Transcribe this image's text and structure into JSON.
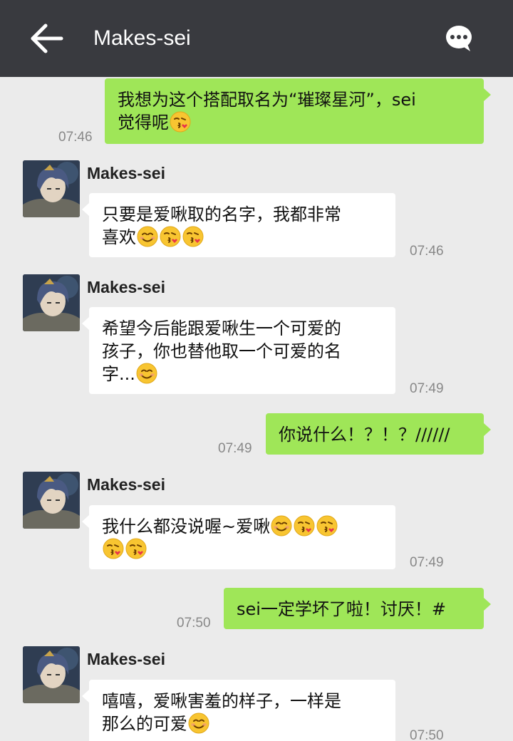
{
  "header": {
    "title": "Makes-sei",
    "back_icon": "arrow-left-icon",
    "menu_icon": "chat-bubble-icon"
  },
  "messages": [
    {
      "dir": "out",
      "time": "07:46",
      "lines": [
        "我想为这个搭配取名为“璀璨星河”，sei",
        "觉得呢"
      ],
      "emoji": [
        "kiss"
      ]
    },
    {
      "dir": "in",
      "sender": "Makes-sei",
      "time": "07:46",
      "lines": [
        "只要是爱啾取的名字，我都非常",
        "喜欢"
      ],
      "emoji": [
        "smile",
        "kiss",
        "kiss"
      ]
    },
    {
      "dir": "in",
      "sender": "Makes-sei",
      "time": "07:49",
      "lines": [
        "希望今后能跟爱啾生一个可爱的",
        "孩子，你也替他取一个可爱的名",
        "字..."
      ],
      "emoji": [
        "smile"
      ]
    },
    {
      "dir": "out",
      "time": "07:49",
      "lines": [
        "你说什么！？！？//////"
      ],
      "emoji": []
    },
    {
      "dir": "in",
      "sender": "Makes-sei",
      "time": "07:49",
      "lines": [
        "我什么都没说喔~爱啾",
        ""
      ],
      "emoji": [
        "smile",
        "kiss",
        "kiss",
        "kiss",
        "kiss"
      ]
    },
    {
      "dir": "out",
      "time": "07:50",
      "lines": [
        "sei一定学坏了啦！讨厌！#"
      ],
      "emoji": []
    },
    {
      "dir": "in",
      "sender": "Makes-sei",
      "time": "07:50",
      "lines": [
        "嘻嘻，爱啾害羞的样子，一样是",
        "那么的可爱"
      ],
      "emoji": [
        "smile"
      ]
    }
  ],
  "colors": {
    "topbar": "#393a3f",
    "outgoing_bubble": "#9fe658",
    "incoming_bubble": "#ffffff",
    "background": "#ebebeb"
  }
}
